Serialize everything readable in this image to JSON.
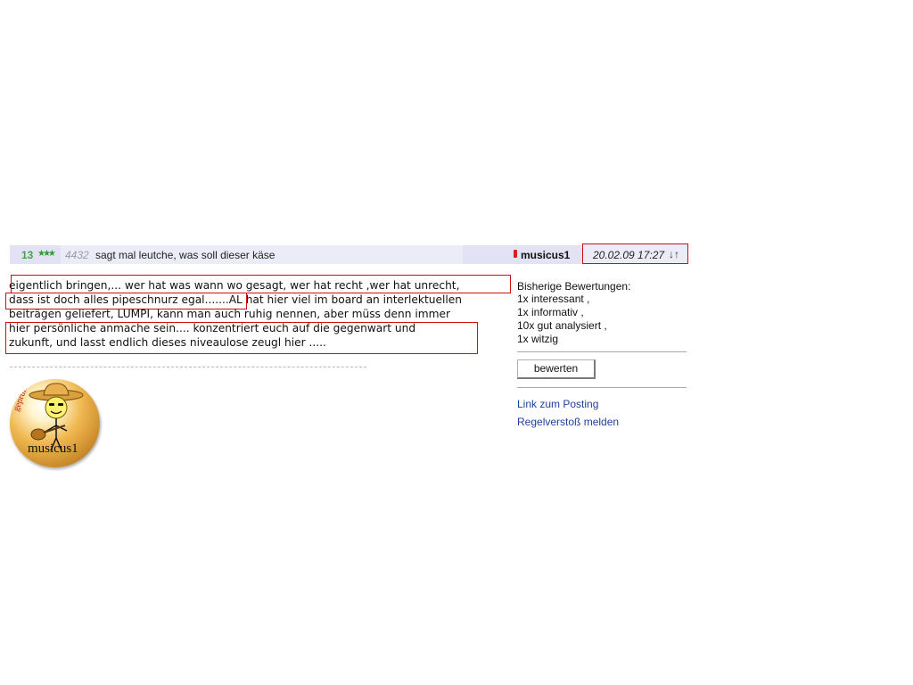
{
  "post_header": {
    "rating": "13",
    "stars": "★★★",
    "post_number": "4432",
    "title": "sagt mal leutche, was soll dieser käse",
    "author": "musicus1",
    "date": "20.02.09 17:27",
    "nav_arrows": "↓↑"
  },
  "post_body": {
    "lines": [
      "eigentlich bringen,... wer hat was wann wo gesagt, wer hat recht ,wer hat unrecht,",
      "dass ist doch alles pipeschnurz egal.......AL hat hier viel im board an interlektuellen",
      "beiträgen geliefert, LUMPI,  kann man auch ruhig nennen, aber müss denn immer",
      "hier  persönliche anmache  sein.... konzentriert euch auf die gegenwart und",
      "zukunft, und  lasst endlich dieses niveaulose  zeugl hier ....."
    ]
  },
  "avatar": {
    "label": "musicus1",
    "badge_text": "geprüft"
  },
  "ratings": {
    "title": "Bisherige Bewertungen:",
    "items": [
      "1x interessant ,",
      "1x informativ ,",
      "10x gut analysiert ,",
      "1x witzig"
    ]
  },
  "actions": {
    "rate_button": "bewerten",
    "link_posting": "Link zum Posting",
    "report": "Regelverstoß melden"
  },
  "colors": {
    "header_bg": "#ececf8",
    "highlight_border": "#d01010",
    "link": "#1f3fa0",
    "rating_green": "#3caa3c"
  }
}
